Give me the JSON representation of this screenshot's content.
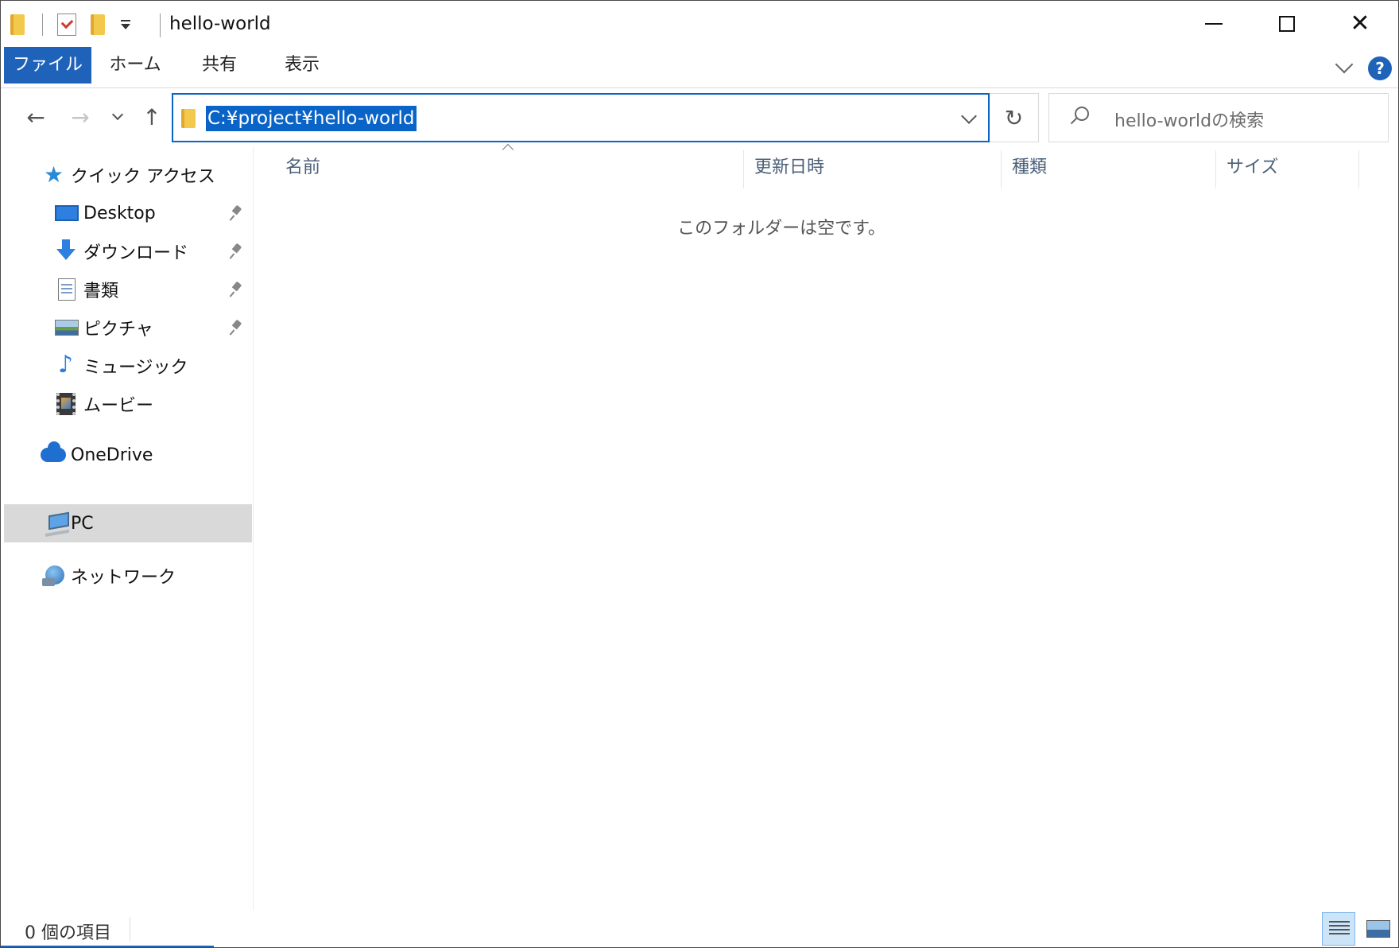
{
  "window": {
    "title": "hello-world",
    "controls": {
      "minimize": "minimize",
      "maximize": "maximize",
      "close": "✕"
    }
  },
  "ribbon": {
    "tabs": [
      {
        "label": "ファイル",
        "active": true
      },
      {
        "label": "ホーム",
        "active": false
      },
      {
        "label": "共有",
        "active": false
      },
      {
        "label": "表示",
        "active": false
      }
    ],
    "help_label": "?"
  },
  "navigation": {
    "back_icon": "←",
    "forward_icon": "→",
    "up_icon": "↑",
    "refresh_icon": "↻",
    "address": "C:¥project¥hello-world",
    "search_placeholder": "hello-worldの検索"
  },
  "sidebar": {
    "quick_access": "クイック アクセス",
    "items": [
      {
        "label": "Desktop",
        "icon": "desktop-icon",
        "pinned": true
      },
      {
        "label": "ダウンロード",
        "icon": "download-icon",
        "pinned": true
      },
      {
        "label": "書類",
        "icon": "document-icon",
        "pinned": true
      },
      {
        "label": "ピクチャ",
        "icon": "picture-icon",
        "pinned": true
      },
      {
        "label": "ミュージック",
        "icon": "music-icon",
        "pinned": false
      },
      {
        "label": "ムービー",
        "icon": "movie-icon",
        "pinned": false
      }
    ],
    "onedrive": "OneDrive",
    "pc": "PC",
    "network": "ネットワーク",
    "star_icon": "★",
    "music_glyph": "♪"
  },
  "content": {
    "columns": [
      "名前",
      "更新日時",
      "種類",
      "サイズ"
    ],
    "empty_message": "このフォルダーは空です。"
  },
  "status": {
    "item_count": "0 個の項目"
  },
  "colors": {
    "accent": "#1e63b9",
    "address_highlight": "#0a64c8",
    "selected_bg": "#d9d9d9"
  }
}
